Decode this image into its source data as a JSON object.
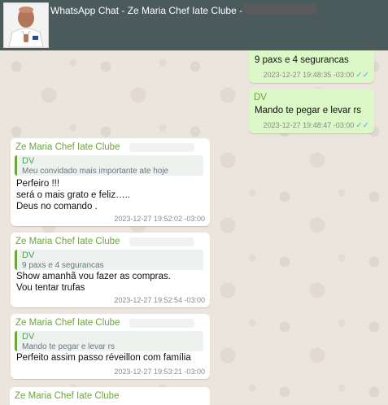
{
  "window": {
    "title": "WhatsApp Chat - Ze Maria Chef Iate Clube -"
  },
  "colors": {
    "header": "#4b5b5c",
    "outgoing": "#dcf8c6",
    "incoming": "#ffffff",
    "sender": "#6ca53c",
    "tick": "#4fb6ec"
  },
  "messages": [
    {
      "dir": "out",
      "text": "9 paxs e 4 segurancas",
      "time": "2023-12-27 19:48:35 -03:00"
    },
    {
      "dir": "out",
      "sender": "DV",
      "text": "Mando te pegar e levar rs",
      "time": "2023-12-27 19:48:47 -03:00"
    },
    {
      "dir": "in",
      "sender": "Ze Maria Chef Iate Clube",
      "quote": {
        "name": "DV",
        "text": "Meu convidado mais importante ate hoje"
      },
      "lines": [
        "Perfeiro !!!",
        "será o mais grato e feliz…..",
        "Deus no comando ."
      ],
      "time": "2023-12-27 19:52:02 -03:00"
    },
    {
      "dir": "in",
      "sender": "Ze Maria Chef Iate Clube",
      "quote": {
        "name": "DV",
        "text": "9 paxs e 4 segurancas"
      },
      "lines": [
        "Show amanhã vou fazer as compras.",
        "Vou tentar trufas"
      ],
      "time": "2023-12-27 19:52:54 -03:00"
    },
    {
      "dir": "in",
      "sender": "Ze Maria Chef Iate Clube",
      "quote": {
        "name": "DV",
        "text": "Mando te pegar e levar rs"
      },
      "lines": [
        "Perfeito assim passo réveillon com família"
      ],
      "time": "2023-12-27 19:53:21 -03:00"
    },
    {
      "dir": "in",
      "sender": "Ze Maria Chef Iate Clube"
    }
  ]
}
